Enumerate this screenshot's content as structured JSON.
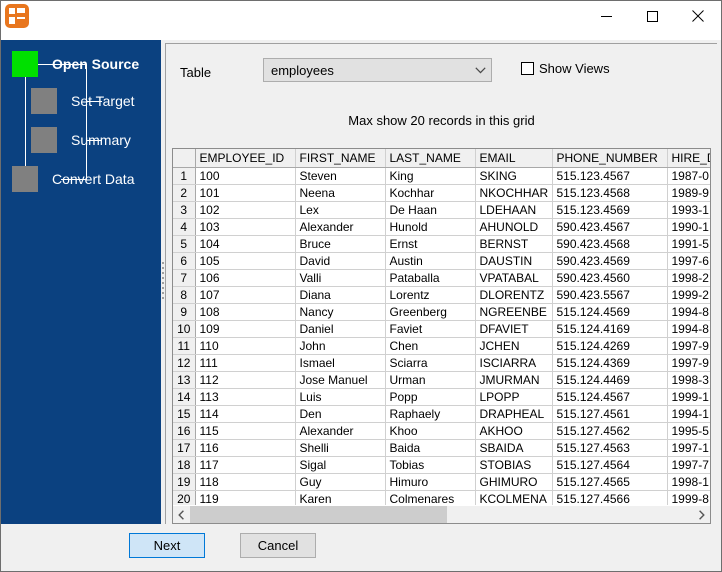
{
  "window": {
    "title": "",
    "icon": "app-icon",
    "controls": {
      "minimize": "minimize-icon",
      "maximize": "maximize-icon",
      "close": "close-icon"
    }
  },
  "sidebar": {
    "steps": [
      {
        "label": "Open Source",
        "state": "active"
      },
      {
        "label": "Set Target",
        "state": "inactive"
      },
      {
        "label": "Summary",
        "state": "inactive"
      },
      {
        "label": "Convert Data",
        "state": "inactive"
      }
    ],
    "colors": {
      "background": "#0b4180",
      "active_box": "#00e000",
      "inactive_box": "#808080"
    }
  },
  "form": {
    "table_label": "Table",
    "table_value": "employees",
    "table_placeholder": "employees",
    "dropdown_icon": "chevron-down-icon",
    "show_views_label": "Show Views",
    "show_views_checked": false,
    "max_records_note": "Max show 20 records in this grid"
  },
  "grid": {
    "columns": [
      "EMPLOYEE_ID",
      "FIRST_NAME",
      "LAST_NAME",
      "EMAIL",
      "PHONE_NUMBER",
      "HIRE_DATE"
    ],
    "rows": [
      {
        "n": "1",
        "cells": [
          "100",
          "Steven",
          "King",
          "SKING",
          "515.123.4567",
          "1987-0"
        ]
      },
      {
        "n": "2",
        "cells": [
          "101",
          "Neena",
          "Kochhar",
          "NKOCHHAR",
          "515.123.4568",
          "1989-9"
        ]
      },
      {
        "n": "3",
        "cells": [
          "102",
          "Lex",
          "De Haan",
          "LDEHAAN",
          "515.123.4569",
          "1993-1"
        ]
      },
      {
        "n": "4",
        "cells": [
          "103",
          "Alexander",
          "Hunold",
          "AHUNOLD",
          "590.423.4567",
          "1990-1"
        ]
      },
      {
        "n": "5",
        "cells": [
          "104",
          "Bruce",
          "Ernst",
          "BERNST",
          "590.423.4568",
          "1991-5"
        ]
      },
      {
        "n": "6",
        "cells": [
          "105",
          "David",
          "Austin",
          "DAUSTIN",
          "590.423.4569",
          "1997-6"
        ]
      },
      {
        "n": "7",
        "cells": [
          "106",
          "Valli",
          "Pataballa",
          "VPATABAL",
          "590.423.4560",
          "1998-2"
        ]
      },
      {
        "n": "8",
        "cells": [
          "107",
          "Diana",
          "Lorentz",
          "DLORENTZ",
          "590.423.5567",
          "1999-2"
        ]
      },
      {
        "n": "9",
        "cells": [
          "108",
          "Nancy",
          "Greenberg",
          "NGREENBE",
          "515.124.4569",
          "1994-8"
        ]
      },
      {
        "n": "10",
        "cells": [
          "109",
          "Daniel",
          "Faviet",
          "DFAVIET",
          "515.124.4169",
          "1994-8"
        ]
      },
      {
        "n": "11",
        "cells": [
          "110",
          "John",
          "Chen",
          "JCHEN",
          "515.124.4269",
          "1997-9"
        ]
      },
      {
        "n": "12",
        "cells": [
          "111",
          "Ismael",
          "Sciarra",
          "ISCIARRA",
          "515.124.4369",
          "1997-9"
        ]
      },
      {
        "n": "13",
        "cells": [
          "112",
          "Jose Manuel",
          "Urman",
          "JMURMAN",
          "515.124.4469",
          "1998-3"
        ]
      },
      {
        "n": "14",
        "cells": [
          "113",
          "Luis",
          "Popp",
          "LPOPP",
          "515.124.4567",
          "1999-1"
        ]
      },
      {
        "n": "15",
        "cells": [
          "114",
          "Den",
          "Raphaely",
          "DRAPHEAL",
          "515.127.4561",
          "1994-1"
        ]
      },
      {
        "n": "16",
        "cells": [
          "115",
          "Alexander",
          "Khoo",
          "AKHOO",
          "515.127.4562",
          "1995-5"
        ]
      },
      {
        "n": "17",
        "cells": [
          "116",
          "Shelli",
          "Baida",
          "SBAIDA",
          "515.127.4563",
          "1997-1"
        ]
      },
      {
        "n": "18",
        "cells": [
          "117",
          "Sigal",
          "Tobias",
          "STOBIAS",
          "515.127.4564",
          "1997-7"
        ]
      },
      {
        "n": "19",
        "cells": [
          "118",
          "Guy",
          "Himuro",
          "GHIMURO",
          "515.127.4565",
          "1998-1"
        ]
      },
      {
        "n": "20",
        "cells": [
          "119",
          "Karen",
          "Colmenares",
          "KCOLMENA",
          "515.127.4566",
          "1999-8"
        ]
      }
    ],
    "hscroll": {
      "left_icon": "chevron-left-icon",
      "right_icon": "chevron-right-icon",
      "thumb_percent": 51
    }
  },
  "footer": {
    "next_label": "Next",
    "cancel_label": "Cancel"
  }
}
